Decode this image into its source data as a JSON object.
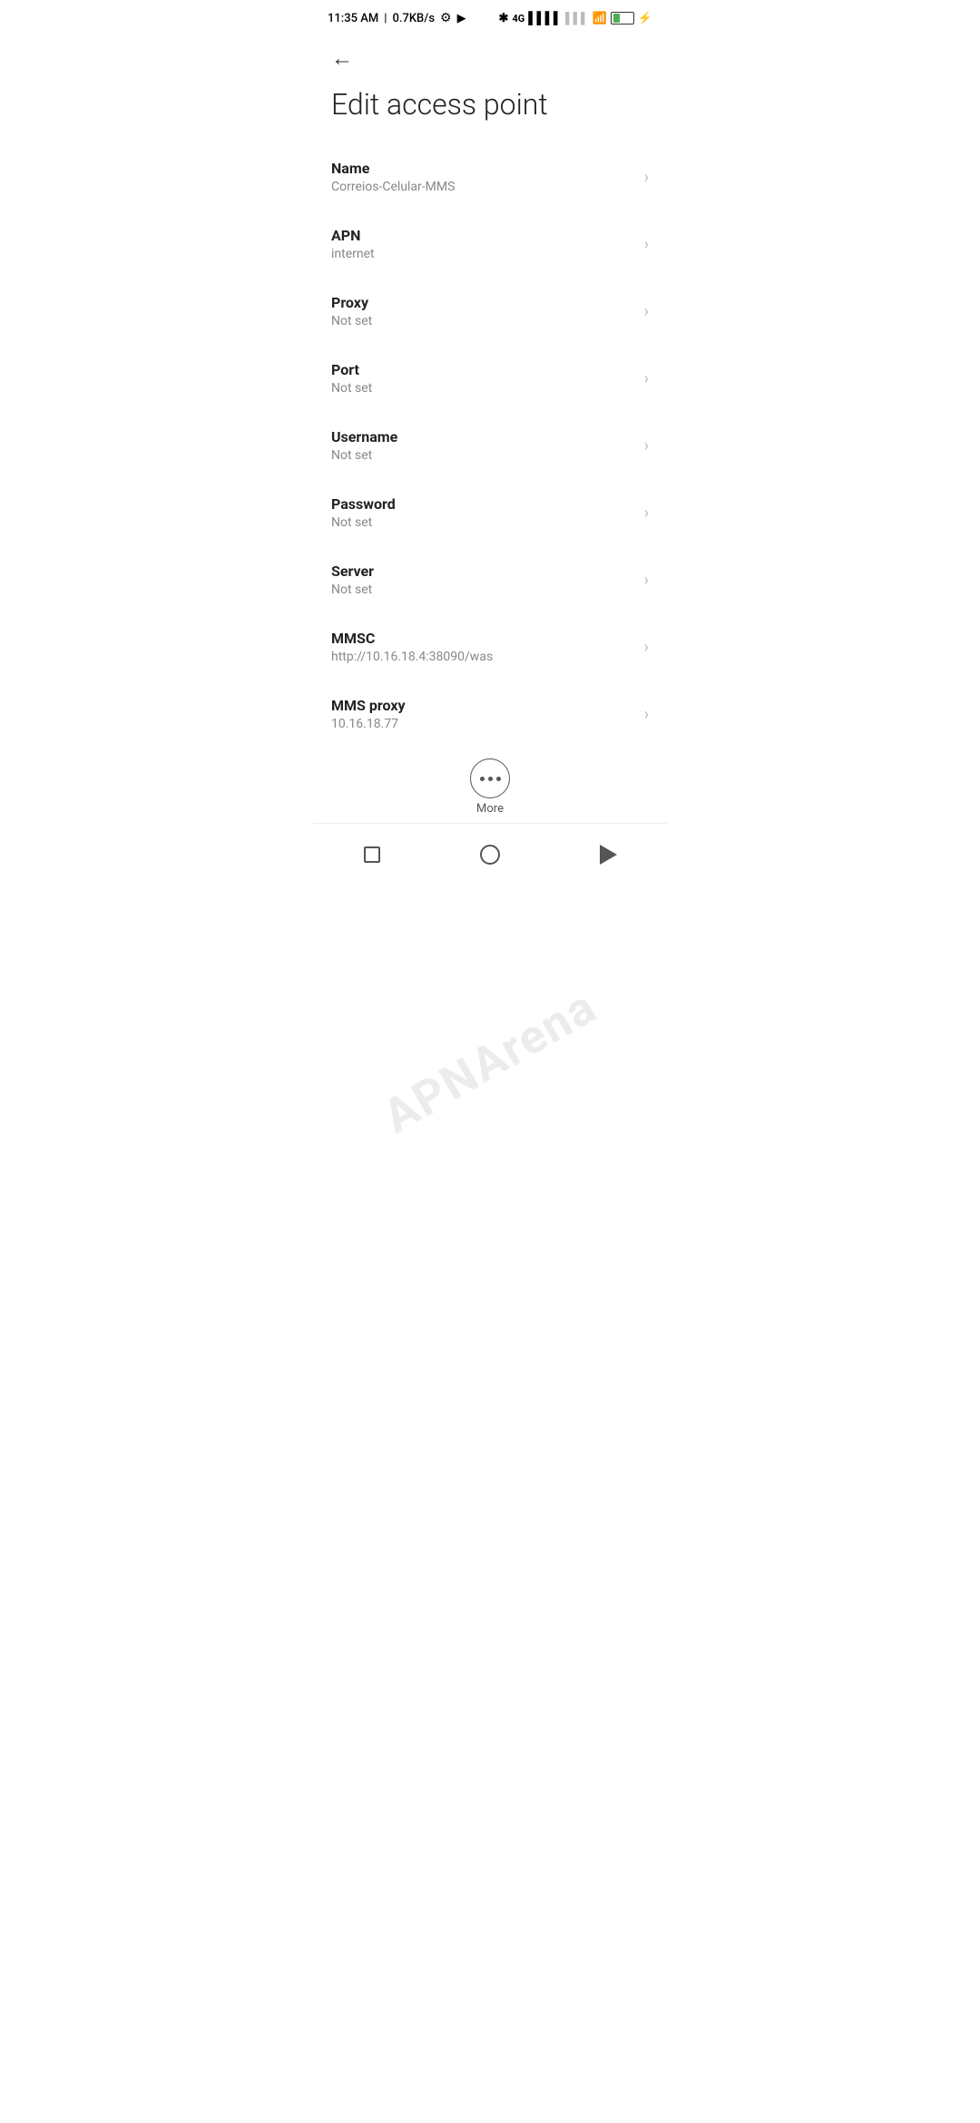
{
  "statusBar": {
    "time": "11:35 AM",
    "network": "0.7KB/s"
  },
  "header": {
    "backLabel": "←",
    "title": "Edit access point"
  },
  "fields": [
    {
      "id": "name",
      "label": "Name",
      "value": "Correios-Celular-MMS"
    },
    {
      "id": "apn",
      "label": "APN",
      "value": "internet"
    },
    {
      "id": "proxy",
      "label": "Proxy",
      "value": "Not set"
    },
    {
      "id": "port",
      "label": "Port",
      "value": "Not set"
    },
    {
      "id": "username",
      "label": "Username",
      "value": "Not set"
    },
    {
      "id": "password",
      "label": "Password",
      "value": "Not set"
    },
    {
      "id": "server",
      "label": "Server",
      "value": "Not set"
    },
    {
      "id": "mmsc",
      "label": "MMSC",
      "value": "http://10.16.18.4:38090/was"
    },
    {
      "id": "mms-proxy",
      "label": "MMS proxy",
      "value": "10.16.18.77"
    }
  ],
  "more": {
    "label": "More"
  },
  "watermark": "APNArena"
}
